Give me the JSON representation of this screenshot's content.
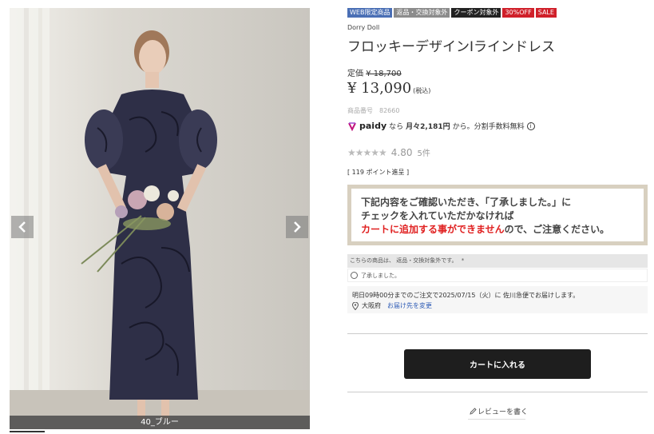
{
  "gallery": {
    "caption": "40_ブルー",
    "prev_icon": "chevron-left-icon",
    "next_icon": "chevron-right-icon"
  },
  "badges": [
    {
      "label": "WEB限定商品",
      "color": "#4a6fb5"
    },
    {
      "label": "返品・交換対象外",
      "color": "#8c8c8c"
    },
    {
      "label": "クーポン対象外",
      "color": "#222222"
    },
    {
      "label": "30%OFF",
      "color": "#d0202a"
    },
    {
      "label": "SALE",
      "color": "#d0202a"
    }
  ],
  "product": {
    "brand": "Dorry Doll",
    "title": "フロッキーデザインIラインドレス",
    "list_price_label": "定価",
    "list_price": "¥ 18,700",
    "sale_price": "¥ 13,090",
    "tax_label": "(税込)",
    "sku_label": "商品番号",
    "sku": "82660"
  },
  "paidy": {
    "logo": "paidy",
    "text_before": "なら",
    "monthly": "月々2,181円",
    "text_after": "から。分割手数料無料",
    "info_icon": "info-icon"
  },
  "rating": {
    "stars": "★★★★★",
    "score": "4.80",
    "count": "5件",
    "value": 4.8
  },
  "points": "[ 119 ポイント進呈 ]",
  "notice": {
    "line1": "下記内容をご確認いただき、「了承しました。」に",
    "line2": "チェックを入れていただかなければ",
    "line3_red": "カートに追加する事ができません",
    "line3_rest": "ので、ご注意ください。"
  },
  "consent": {
    "header": "こちらの商品は、 返品・交換対象外です。",
    "required_mark": "*",
    "option": "了承しました。"
  },
  "delivery": {
    "text": "明日09時00分までのご注文で2025/07/15（火）に 佐川急便でお届けします。",
    "region": "大阪府",
    "change_link": "お届け先を変更"
  },
  "cart_button": "カートに入れる",
  "review_link": "レビューを書く",
  "colors": {
    "accent_red": "#e02020",
    "button_bg": "#1e1e1e",
    "notice_border": "#d8d0c0"
  }
}
